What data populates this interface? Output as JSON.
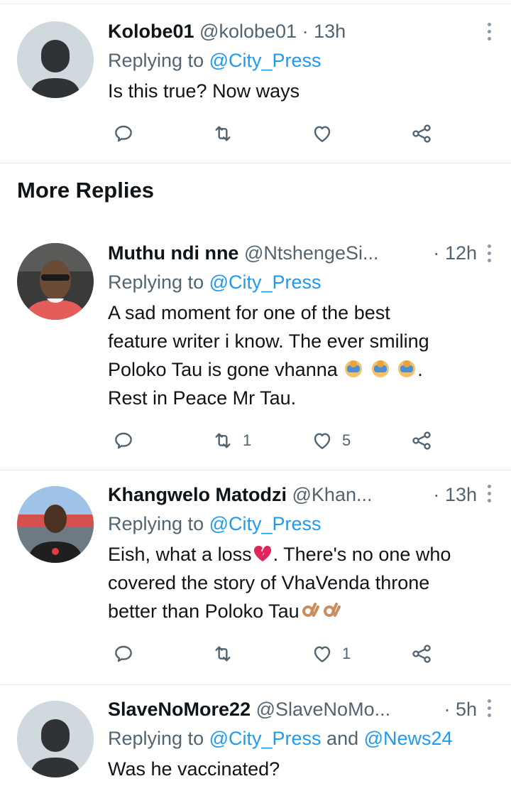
{
  "tweets": [
    {
      "name": "Kolobe01",
      "handle": "@kolobe01",
      "dot": "·",
      "time": "13h",
      "reply_prefix": "Replying to ",
      "mention1": "@City_Press",
      "reply_mid": "",
      "mention2": "",
      "lines": [
        "Is this true? Now ways"
      ],
      "replies": "",
      "retweets": "",
      "likes": ""
    },
    {
      "name": "Muthu ndi nne",
      "handle": "@NtshengeSi...",
      "dot": "·",
      "time": "12h",
      "reply_prefix": "Replying to ",
      "mention1": "@City_Press",
      "lines": [
        "A sad moment for one of the best",
        "feature writer i know. The ever smiling",
        "Poloko Tau is gone vhanna",
        "Rest in Peace Mr Tau."
      ],
      "line3_suffix": ".",
      "replies": "",
      "retweets": "1",
      "likes": "5"
    },
    {
      "name": "Khangwelo Matodzi",
      "handle": "@Khan...",
      "dot": "·",
      "time": "13h",
      "reply_prefix": "Replying to ",
      "mention1": "@City_Press",
      "lines": [
        "Eish, what a loss",
        ". There's no one who",
        "covered the story of VhaVenda throne",
        "better than Poloko Tau"
      ],
      "replies": "",
      "retweets": "",
      "likes": "1"
    },
    {
      "name": "SlaveNoMore22",
      "handle": "@SlaveNoMo...",
      "dot": "·",
      "time": "5h",
      "reply_prefix": "Replying to ",
      "mention1": "@City_Press",
      "reply_mid": " and ",
      "mention2": "@News24",
      "lines": [
        "Was he vaccinated?"
      ]
    }
  ],
  "section_title": "More Replies",
  "icons": {
    "reply": "reply-icon",
    "retweet": "retweet-icon",
    "like": "heart-icon",
    "share": "share-icon",
    "more": "more-vertical-icon"
  },
  "colors": {
    "link": "#1d9bf0",
    "secondary": "#536471",
    "text": "#0f1419"
  }
}
